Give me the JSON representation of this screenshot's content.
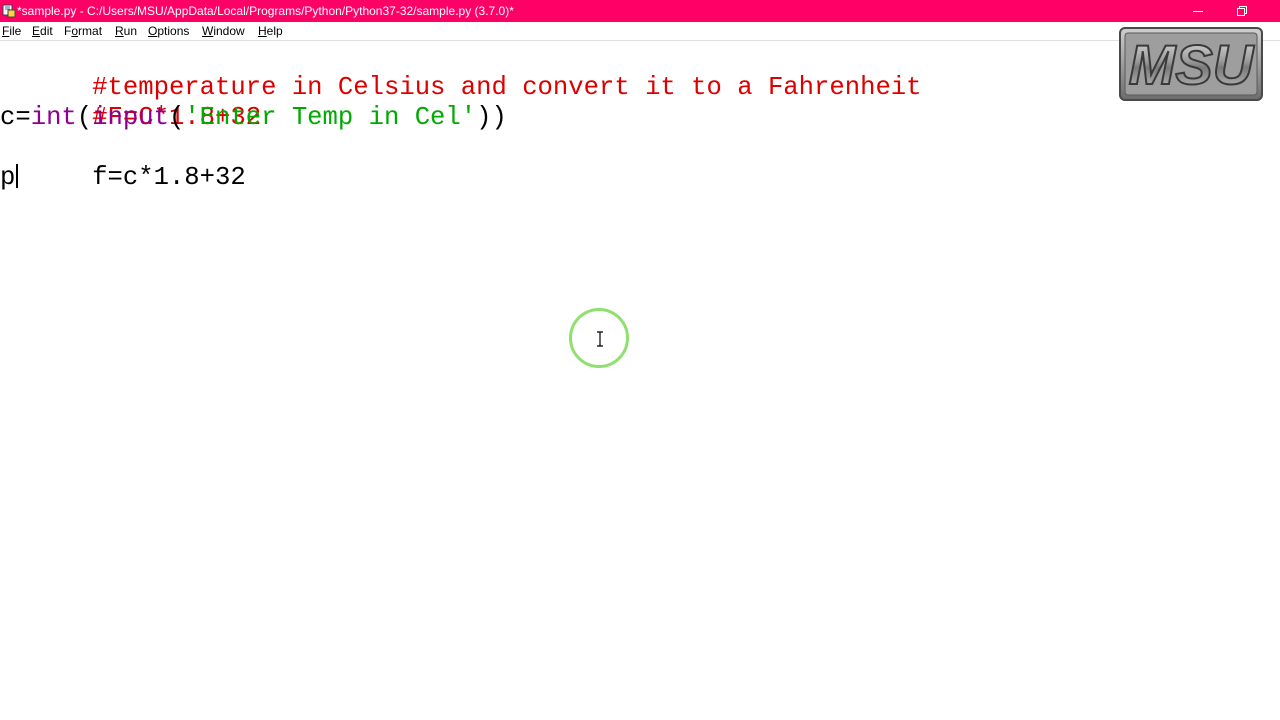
{
  "window": {
    "title": "*sample.py - C:/Users/MSU/AppData/Local/Programs/Python/Python37-32/sample.py (3.7.0)*",
    "titlebar_color": "#ff0066"
  },
  "menu": {
    "items": [
      {
        "label_acc": "F",
        "label_rest": "ile"
      },
      {
        "label_acc": "E",
        "label_rest": "dit"
      },
      {
        "label_pre": "F",
        "label_acc": "o",
        "label_rest": "rmat"
      },
      {
        "label_acc": "R",
        "label_rest": "un"
      },
      {
        "label_acc": "O",
        "label_rest": "ptions"
      },
      {
        "label_acc": "W",
        "label_rest": "indow"
      },
      {
        "label_acc": "H",
        "label_rest": "elp"
      }
    ]
  },
  "editor": {
    "lines": {
      "line1": "#temperature in Celsius and convert it to a Fahrenheit",
      "line2": "#F=C*1.8+32",
      "line3_a": "c=",
      "line3_b": "int",
      "line3_c": "(",
      "line3_d": "input",
      "line3_e": "(",
      "line3_f": "'Enter Temp in Cel'",
      "line3_g": "))",
      "line4": "f=c*1.8+32",
      "line5": "p"
    },
    "syntax_colors": {
      "comment": "#dd0000",
      "builtin": "#900090",
      "string": "#00aa00"
    }
  },
  "overlay": {
    "logo_text": "MSU",
    "logo_icon": "msu-logo",
    "cursor_icon": "text-cursor-icon",
    "cursor_ring_color": "#90e070"
  }
}
